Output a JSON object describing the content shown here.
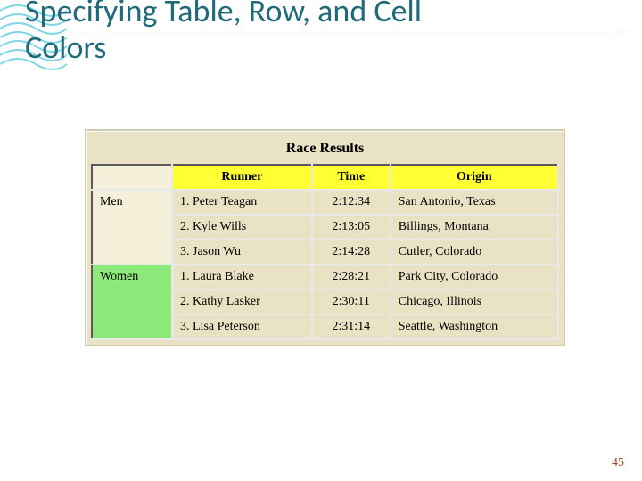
{
  "title": {
    "line1": "Specifying Table, Row, and Cell",
    "line2": "Colors"
  },
  "table": {
    "caption": "Race Results",
    "headers": {
      "runner": "Runner",
      "time": "Time",
      "origin": "Origin"
    },
    "groups": [
      {
        "label": "Men",
        "rows": [
          {
            "runner": "1. Peter Teagan",
            "time": "2:12:34",
            "origin": "San Antonio, Texas"
          },
          {
            "runner": "2. Kyle Wills",
            "time": "2:13:05",
            "origin": "Billings, Montana"
          },
          {
            "runner": "3. Jason Wu",
            "time": "2:14:28",
            "origin": "Cutler, Colorado"
          }
        ]
      },
      {
        "label": "Women",
        "rows": [
          {
            "runner": "1. Laura Blake",
            "time": "2:28:21",
            "origin": "Park City, Colorado"
          },
          {
            "runner": "2. Kathy Lasker",
            "time": "2:30:11",
            "origin": "Chicago, Illinois"
          },
          {
            "runner": "3. Lisa Peterson",
            "time": "2:31:14",
            "origin": "Seattle, Washington"
          }
        ]
      }
    ]
  },
  "slide_number": "45",
  "colors": {
    "title_text": "#1f6b7a",
    "header_bg": "#ffff33",
    "women_bg": "#8ce97a",
    "table_bg": "#e9e2c4"
  }
}
